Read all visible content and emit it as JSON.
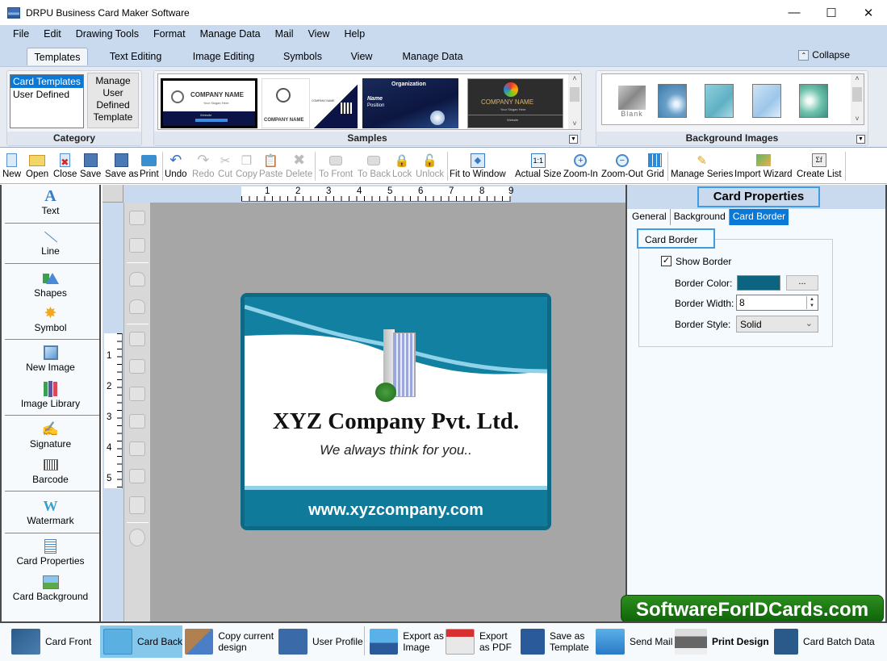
{
  "window": {
    "title": "DRPU Business Card Maker Software",
    "controls": {
      "minimize": "—",
      "maximize": "☐",
      "close": "✕"
    }
  },
  "menu": [
    "File",
    "Edit",
    "Drawing Tools",
    "Format",
    "Manage Data",
    "Mail",
    "View",
    "Help"
  ],
  "ribbon_tabs": [
    {
      "label": "Templates",
      "active": true
    },
    {
      "label": "Text Editing",
      "active": false
    },
    {
      "label": "Image Editing",
      "active": false
    },
    {
      "label": "Symbols",
      "active": false
    },
    {
      "label": "View",
      "active": false
    },
    {
      "label": "Manage Data",
      "active": false
    }
  ],
  "collapse_label": "Collapse",
  "category": {
    "label": "Category",
    "items": [
      {
        "label": "Card Templates",
        "selected": true
      },
      {
        "label": "User Defined",
        "selected": false
      }
    ],
    "manage_button": "Manage User Defined Template"
  },
  "samples": {
    "label": "Samples",
    "thumbs": [
      {
        "company": "COMPANY NAME",
        "slogan": "Your Slogan Here",
        "website": "Website"
      },
      {
        "company": "COMPANY NAME",
        "company2": "COMPANY NAME"
      },
      {
        "org": "Organization",
        "name": "Name",
        "position": "Position"
      },
      {
        "company": "COMPANY NAME",
        "slogan": "Your Slogan Here",
        "website": "Website"
      }
    ]
  },
  "background_images": {
    "label": "Background Images",
    "blank_label": "Blank"
  },
  "toolbar": [
    {
      "label": "New",
      "icon": "new-file-icon",
      "enabled": true
    },
    {
      "label": "Open",
      "icon": "open-folder-icon",
      "enabled": true
    },
    {
      "label": "Close",
      "icon": "close-file-icon",
      "enabled": true
    },
    {
      "label": "Save",
      "icon": "save-icon",
      "enabled": true
    },
    {
      "label": "Save as",
      "icon": "save-as-icon",
      "enabled": true
    },
    {
      "label": "Print",
      "icon": "print-icon",
      "enabled": true
    },
    {
      "label": "Undo",
      "icon": "undo-icon",
      "enabled": true
    },
    {
      "label": "Redo",
      "icon": "redo-icon",
      "enabled": false
    },
    {
      "label": "Cut",
      "icon": "cut-icon",
      "enabled": false
    },
    {
      "label": "Copy",
      "icon": "copy-icon",
      "enabled": false
    },
    {
      "label": "Paste",
      "icon": "paste-icon",
      "enabled": false
    },
    {
      "label": "Delete",
      "icon": "delete-icon",
      "enabled": false
    },
    {
      "label": "To Front",
      "icon": "to-front-icon",
      "enabled": false
    },
    {
      "label": "To Back",
      "icon": "to-back-icon",
      "enabled": false
    },
    {
      "label": "Lock",
      "icon": "lock-icon",
      "enabled": false
    },
    {
      "label": "Unlock",
      "icon": "unlock-icon",
      "enabled": false
    },
    {
      "label": "Fit to Window",
      "icon": "fit-window-icon",
      "enabled": true
    },
    {
      "label": "Actual Size",
      "icon": "actual-size-icon",
      "enabled": true
    },
    {
      "label": "Zoom-In",
      "icon": "zoom-in-icon",
      "enabled": true
    },
    {
      "label": "Zoom-Out",
      "icon": "zoom-out-icon",
      "enabled": true
    },
    {
      "label": "Grid",
      "icon": "grid-icon",
      "enabled": true
    },
    {
      "label": "Manage Series",
      "icon": "manage-series-icon",
      "enabled": true
    },
    {
      "label": "Import Wizard",
      "icon": "import-wizard-icon",
      "enabled": true
    },
    {
      "label": "Create List",
      "icon": "create-list-icon",
      "enabled": true
    }
  ],
  "left_tools": [
    {
      "label": "Text",
      "icon": "text-icon"
    },
    {
      "label": "Line",
      "icon": "line-icon"
    },
    {
      "label": "Shapes",
      "icon": "shapes-icon"
    },
    {
      "label": "Symbol",
      "icon": "symbol-icon"
    },
    {
      "label": "New Image",
      "icon": "new-image-icon"
    },
    {
      "label": "Image Library",
      "icon": "image-library-icon"
    },
    {
      "label": "Signature",
      "icon": "signature-icon"
    },
    {
      "label": "Barcode",
      "icon": "barcode-icon"
    },
    {
      "label": "Watermark",
      "icon": "watermark-icon"
    },
    {
      "label": "Card Properties",
      "icon": "card-properties-icon"
    },
    {
      "label": "Card Background",
      "icon": "card-background-icon"
    }
  ],
  "rulers": {
    "horizontal": [
      "1",
      "2",
      "3",
      "4",
      "5",
      "6",
      "7",
      "8",
      "9"
    ],
    "vertical": [
      "1",
      "2",
      "3",
      "4",
      "5"
    ]
  },
  "card": {
    "company": "XYZ Company Pvt. Ltd.",
    "slogan": "We always think for you..",
    "website": "www.xyzcompany.com",
    "border_color": "#0e6985",
    "band_color": "#107a9a"
  },
  "properties": {
    "title": "Card Properties",
    "tabs": [
      {
        "label": "General",
        "active": false
      },
      {
        "label": "Background",
        "active": false
      },
      {
        "label": "Card Border",
        "active": true
      }
    ],
    "group_label": "Card Border",
    "show_border_label": "Show Border",
    "show_border_checked": true,
    "border_color_label": "Border Color:",
    "border_color_value": "#0d6480",
    "browse_label": "...",
    "border_width_label": "Border Width:",
    "border_width_value": "8",
    "border_style_label": "Border Style:",
    "border_style_value": "Solid"
  },
  "watermark_text": "SoftwareForIDCards.com",
  "bottom_bar": [
    {
      "label": "Card Front",
      "icon": "card-front-icon",
      "active": false
    },
    {
      "label": "Card Back",
      "icon": "card-back-icon",
      "active": true
    },
    {
      "label": "Copy current design",
      "icon": "copy-design-icon",
      "active": false
    },
    {
      "label": "User Profile",
      "icon": "user-profile-icon",
      "active": false
    },
    {
      "label": "Export as Image",
      "icon": "export-image-icon",
      "active": false
    },
    {
      "label": "Export as PDF",
      "icon": "export-pdf-icon",
      "active": false
    },
    {
      "label": "Save as Template",
      "icon": "save-template-icon",
      "active": false
    },
    {
      "label": "Send Mail",
      "icon": "send-mail-icon",
      "active": false
    },
    {
      "label": "Print Design",
      "icon": "print-design-icon",
      "active": false
    },
    {
      "label": "Card Batch Data",
      "icon": "card-batch-data-icon",
      "active": false
    }
  ]
}
